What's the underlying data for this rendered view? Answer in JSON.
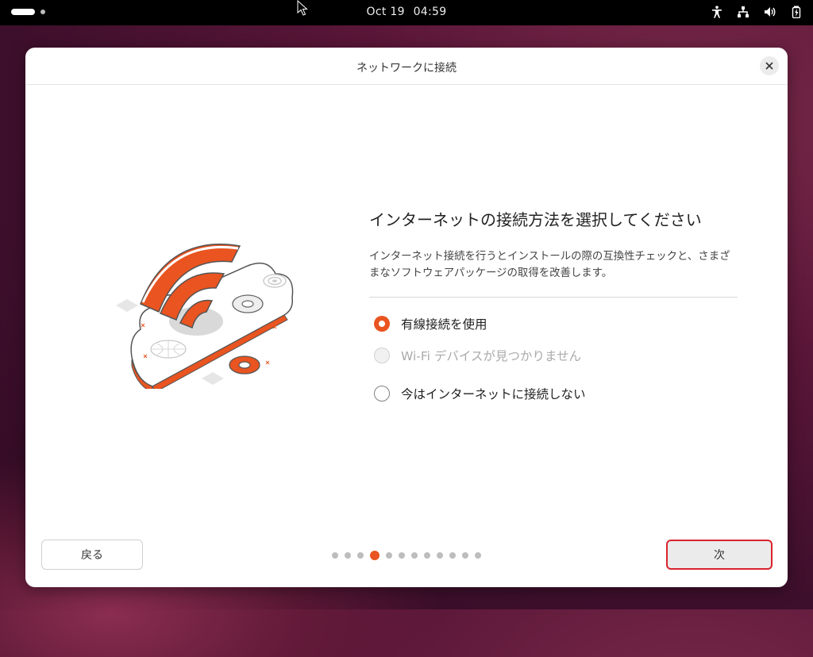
{
  "topbar": {
    "date": "Oct 19",
    "time": "04:59",
    "icons": [
      "accessibility-icon",
      "network-wired-icon",
      "volume-icon",
      "battery-icon"
    ]
  },
  "dialog": {
    "title": "ネットワークに接続",
    "heading": "インターネットの接続方法を選択してください",
    "description": "インターネット接続を行うとインストールの際の互換性チェックと、さまざまなソフトウェアパッケージの取得を改善します。",
    "options": [
      {
        "label": "有線接続を使用",
        "state": "selected"
      },
      {
        "label": "Wi-Fi デバイスが見つかりません",
        "state": "disabled"
      },
      {
        "label": "今はインターネットに接続しない",
        "state": "unselected"
      }
    ],
    "back_label": "戻る",
    "next_label": "次",
    "pager": {
      "total": 12,
      "current": 4
    }
  },
  "colors": {
    "accent": "#e95420",
    "next_highlight": "#d9232e",
    "desktop": "#5a1638"
  }
}
